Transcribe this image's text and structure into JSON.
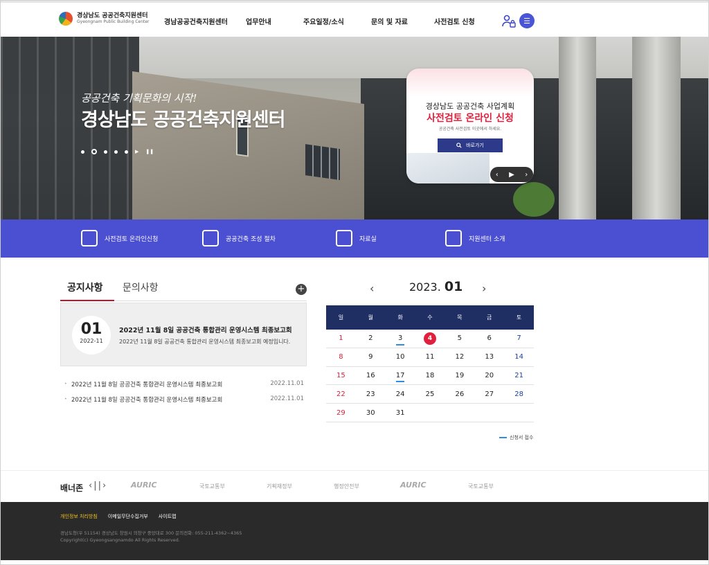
{
  "header": {
    "logo_ko": "경상남도 공공건축지원센터",
    "logo_en": "Gyeongnam Public Building Center",
    "nav": [
      "경남공공건축지원센터",
      "업무안내",
      "주요일정/소식",
      "문의 및 자료",
      "사전검토 신청"
    ],
    "menu_icon": "hamburger-icon",
    "user_icon": "user-lock-icon"
  },
  "hero": {
    "subtitle": "공공건축 기획문화의 시작!",
    "title": "경상남도 공공건축지원센터",
    "popup": {
      "line1": "경상남도 공공건축 사업계획",
      "line2": "사전검토 온라인 신청",
      "line3": "공공건축 사전검토 이곳에서 하세요.",
      "button": "바로가기"
    }
  },
  "quick_links": [
    {
      "label": "사전검토 온라인신청",
      "icon": "online-application-icon"
    },
    {
      "label": "공공건축 조성 절차",
      "icon": "announcement-icon"
    },
    {
      "label": "자료실",
      "icon": "monitor-icon"
    },
    {
      "label": "지원센터 소개",
      "icon": "building-icon"
    }
  ],
  "notices": {
    "tabs": [
      "공지사항",
      "문의사항"
    ],
    "featured": {
      "day": "01",
      "year_month": "2022-11",
      "title": "2022년 11월 8일 공공건축 통합관리 운영시스템 최종보고회",
      "description": "2022년 11월 8일 공공건축 통합관리 운영시스템 최종보고회 예정입니다."
    },
    "list": [
      {
        "title": "2022년 11월 8일 공공건축 통합관리 운영시스템 최종보고회",
        "date": "2022.11.01"
      },
      {
        "title": "2022년 11월 8일 공공건축 통합관리 운영시스템 최종보고회",
        "date": "2022.11.01"
      }
    ]
  },
  "calendar": {
    "year": "2023.",
    "month": "01",
    "weekdays": [
      "일",
      "월",
      "화",
      "수",
      "목",
      "금",
      "토"
    ],
    "weeks": [
      [
        "1",
        "2",
        "3",
        "4",
        "5",
        "6",
        "7"
      ],
      [
        "8",
        "9",
        "10",
        "11",
        "12",
        "13",
        "14"
      ],
      [
        "15",
        "16",
        "17",
        "18",
        "19",
        "20",
        "21"
      ],
      [
        "22",
        "23",
        "24",
        "25",
        "26",
        "27",
        "28"
      ],
      [
        "29",
        "30",
        "31",
        "",
        "",
        "",
        ""
      ]
    ],
    "today": "4",
    "marked_days": [
      "3",
      "17"
    ],
    "legend": "신청서 접수",
    "colors": {
      "sunday": "#d6223c",
      "saturday": "#1d3e9c",
      "today": "#e0203c",
      "mark": "#2f8be3",
      "header": "#1f2e63"
    }
  },
  "banner_zone": {
    "title": "배너존",
    "logos": [
      "AURIC",
      "국토교통부",
      "기획재정부",
      "행정안전부",
      "AURIC",
      "국토교통부"
    ]
  },
  "footer": {
    "links": [
      "개인정보 처리방침",
      "이메일무단수집거부",
      "사이트맵"
    ],
    "address": "경남도청(우 51154) 경상남도 창원시 의창구 중앙대로 300 문의전화: 055-211-4362~4365",
    "copyright": "Copyright(c) Gyeongsangnamdo All Rights Reserved."
  },
  "colors": {
    "brand": "#4b4fd1",
    "accent": "#c4142c",
    "footer_bg": "#2a2a2a"
  }
}
